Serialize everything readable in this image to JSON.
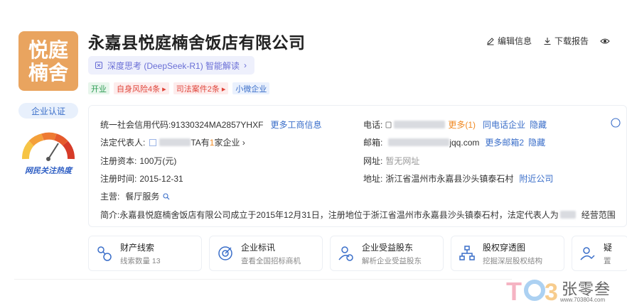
{
  "company": {
    "logo_text": "悦庭\n楠舍",
    "name": "永嘉县悦庭楠舍饭店有限公司",
    "cert_badge": "企业认证",
    "gauge_label": "网民关注热度"
  },
  "actions": {
    "edit": "编辑信息",
    "download": "下载报告"
  },
  "ai_pill": {
    "label": "深度思考 (DeepSeek-R1) 智能解读",
    "chevron": "›"
  },
  "tags": [
    {
      "label": "开业"
    },
    {
      "label": "自身风险4条 ▸"
    },
    {
      "label": "司法案件2条 ▸"
    },
    {
      "label": "小微企业"
    }
  ],
  "info": {
    "credit_code_label": "统一社会信用代码:",
    "credit_code_value": "91330324MA2857YHXF",
    "credit_code_link": "更多工商信息",
    "phone_label": "电话:",
    "phone_more": "更多(1)",
    "phone_same": "同电话企业",
    "phone_hide": "隐藏",
    "rep_label": "法定代表人:",
    "rep_suffix_pre": "TA有",
    "rep_count": "1",
    "rep_suffix_post": "家企业 ›",
    "email_label": "邮箱:",
    "email_value": "jqq.com",
    "email_more": "更多邮箱2",
    "email_hide": "隐藏",
    "capital_label": "注册资本:",
    "capital_value": "100万(元)",
    "website_label": "网址:",
    "website_value": "暂无网址",
    "reg_time_label": "注册时间:",
    "reg_time_value": "2015-12-31",
    "address_label": "地址:",
    "address_value": "浙江省温州市永嘉县沙头镇泰石村",
    "address_link": "附近公司",
    "business_label": "主营:",
    "business_value": "餐厅服务",
    "intro_label": "简介:",
    "intro_value": "永嘉县悦庭楠舍饭店有限公司成立于2015年12月31日，注册地位于浙江省温州市永嘉县沙头镇泰石村，法定代表人为",
    "intro_tail": "经营范围"
  },
  "features": [
    {
      "title": "财产线索",
      "sub": "线索数量 13",
      "icon": "property-clue-icon"
    },
    {
      "title": "企业标讯",
      "sub": "查看全国招标商机",
      "icon": "bid-info-icon"
    },
    {
      "title": "企业受益股东",
      "sub": "解析企业受益股东",
      "icon": "beneficiary-icon"
    },
    {
      "title": "股权穿透图",
      "sub": "挖掘深层股权结构",
      "icon": "equity-chart-icon"
    },
    {
      "title": "疑",
      "sub": "置",
      "icon": "shield-check-icon"
    }
  ],
  "watermark": {
    "text": "张零叁",
    "url": "www.703804.com"
  },
  "colors": {
    "accent": "#3a6ec9",
    "logo_bg": "#e9a45f",
    "risk_red": "#e0453a",
    "orange": "#f08a24"
  }
}
